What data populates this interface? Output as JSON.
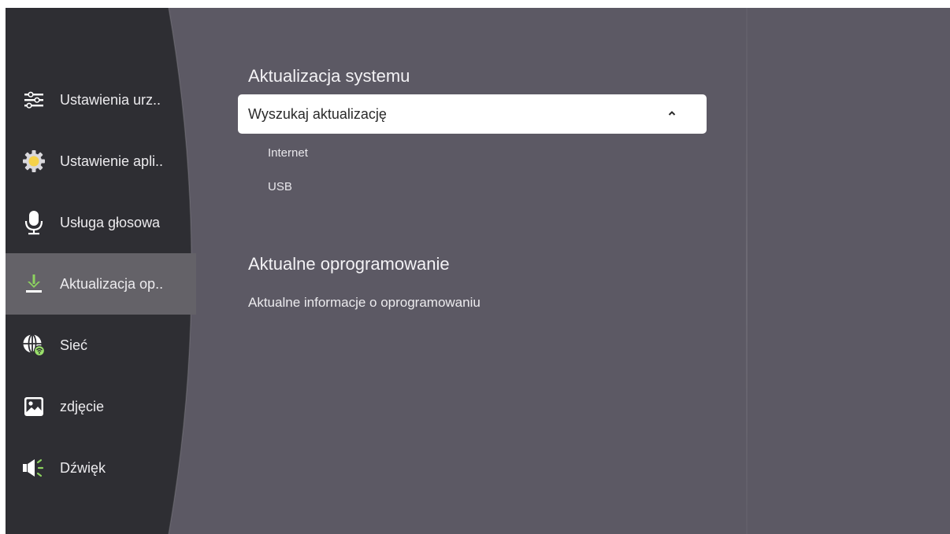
{
  "sidebar": {
    "items": [
      {
        "label": "Ustawienia urz..",
        "icon": "sliders-icon"
      },
      {
        "label": "Ustawienie apli..",
        "icon": "gear-icon"
      },
      {
        "label": "Usługa głosowa",
        "icon": "microphone-icon"
      },
      {
        "label": "Aktualizacja op..",
        "icon": "download-icon",
        "selected": true
      },
      {
        "label": "Sieć",
        "icon": "globe-wifi-icon"
      },
      {
        "label": "zdjęcie",
        "icon": "picture-icon"
      },
      {
        "label": "Dźwięk",
        "icon": "speaker-icon"
      }
    ]
  },
  "main": {
    "system_update": {
      "title": "Aktualizacja systemu",
      "dropdown_label": "Wyszukaj aktualizację",
      "dropdown_state": "expanded",
      "options": [
        "Internet",
        "USB"
      ]
    },
    "current_firmware": {
      "title": "Aktualne oprogramowanie",
      "info_label": "Aktualne informacje o oprogramowaniu"
    }
  },
  "colors": {
    "background": "#5c5964",
    "sidebar": "#2e2e33",
    "selected_item": "#646268",
    "accent_green": "#8dd35f",
    "gear_yellow": "#f5d24a"
  }
}
